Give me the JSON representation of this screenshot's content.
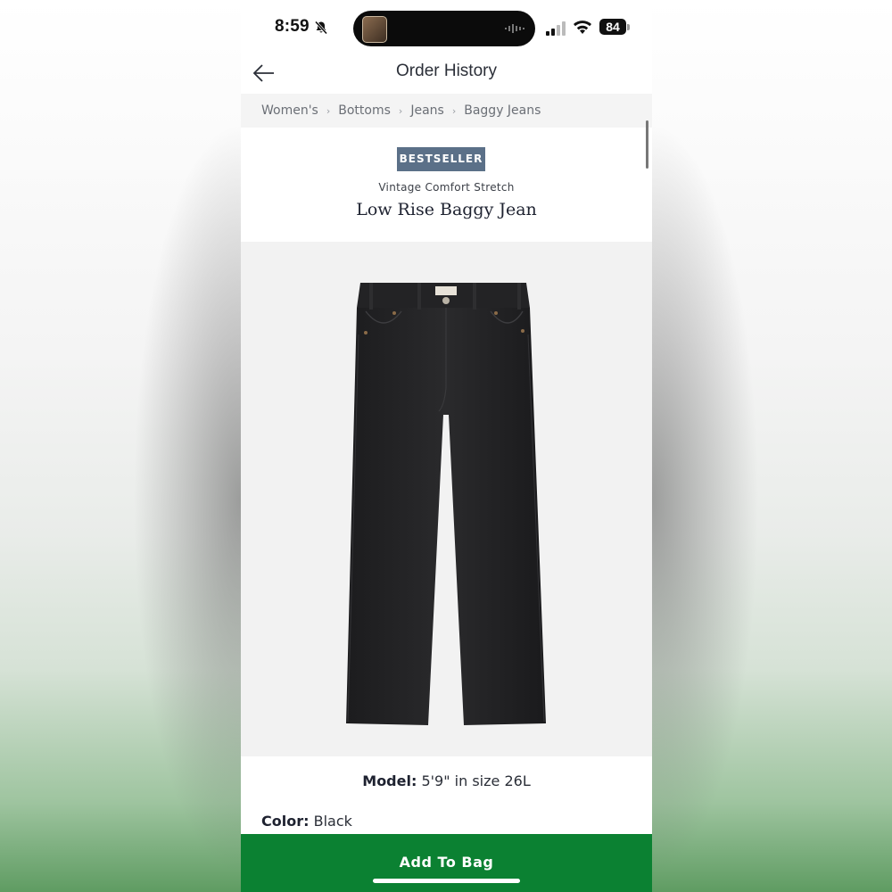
{
  "status_bar": {
    "time": "8:59",
    "battery": "84"
  },
  "nav": {
    "title": "Order History"
  },
  "breadcrumb": {
    "items": [
      "Women's",
      "Bottoms",
      "Jeans",
      "Baggy Jeans"
    ],
    "separator": "›"
  },
  "product": {
    "badge": "BESTSELLER",
    "collection": "Vintage Comfort Stretch",
    "name": "Low Rise Baggy Jean",
    "model_label": "Model:",
    "model_value": "5'9\" in size 26L",
    "color_label": "Color:",
    "color_value": "Black"
  },
  "actions": {
    "add_to_bag": "Add To Bag"
  },
  "colors": {
    "badge_bg": "#5b7088",
    "cta_green": "#0b8132",
    "breadcrumb_bg": "#f4f4f4",
    "image_bg": "#f2f2f2"
  },
  "icons": [
    "bell-slash-icon",
    "signal-icon",
    "wifi-icon",
    "battery-icon",
    "back-arrow-icon"
  ]
}
